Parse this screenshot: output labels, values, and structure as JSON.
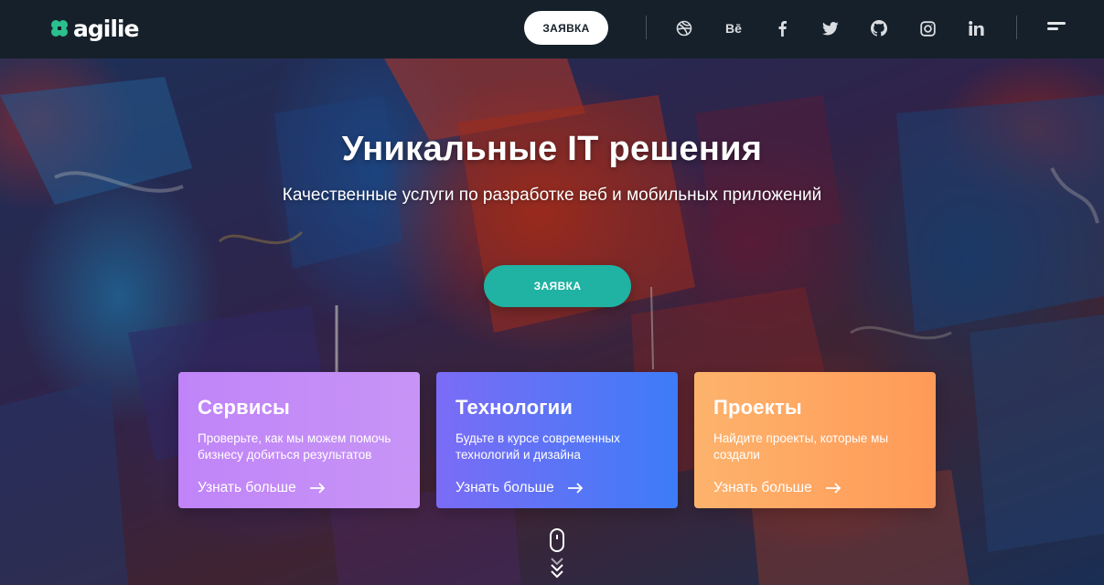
{
  "header": {
    "logo_text": "agilie",
    "logo_icon": "clover-icon",
    "cta_label": "ЗАЯВКА",
    "social": {
      "dribbble": "dribbble-icon",
      "behance_text": "Bē",
      "facebook": "facebook-icon",
      "twitter": "twitter-icon",
      "github": "github-icon",
      "instagram": "instagram-icon",
      "linkedin": "linkedin-icon"
    },
    "menu_icon": "menu-icon"
  },
  "hero": {
    "title": "Уникальные IT решения",
    "subtitle": "Качественные услуги по разработке веб и мобильных приложений",
    "cta_label": "ЗАЯВКА"
  },
  "cards": [
    {
      "title": "Сервисы",
      "text": "Проверьте, как мы можем помочь бизнесу добиться результатов",
      "link": "Узнать больше",
      "color_from": "#c084f8",
      "color_to": "#c794f6"
    },
    {
      "title": "Технологии",
      "text": "Будьте в курсе современных технологий и дизайна",
      "link": "Узнать больше",
      "color_from": "#7b6cf6",
      "color_to": "#3d7cf7"
    },
    {
      "title": "Проекты",
      "text": "Найдите проекты, которые мы создали",
      "link": "Узнать больше",
      "color_from": "#fdb36c",
      "color_to": "#ff9a58"
    }
  ],
  "colors": {
    "header_bg": "#16202a",
    "accent": "#20b2a2",
    "logo_green": "#2bbf8e"
  },
  "scroll_hint_icon": "mouse-scroll-icon"
}
